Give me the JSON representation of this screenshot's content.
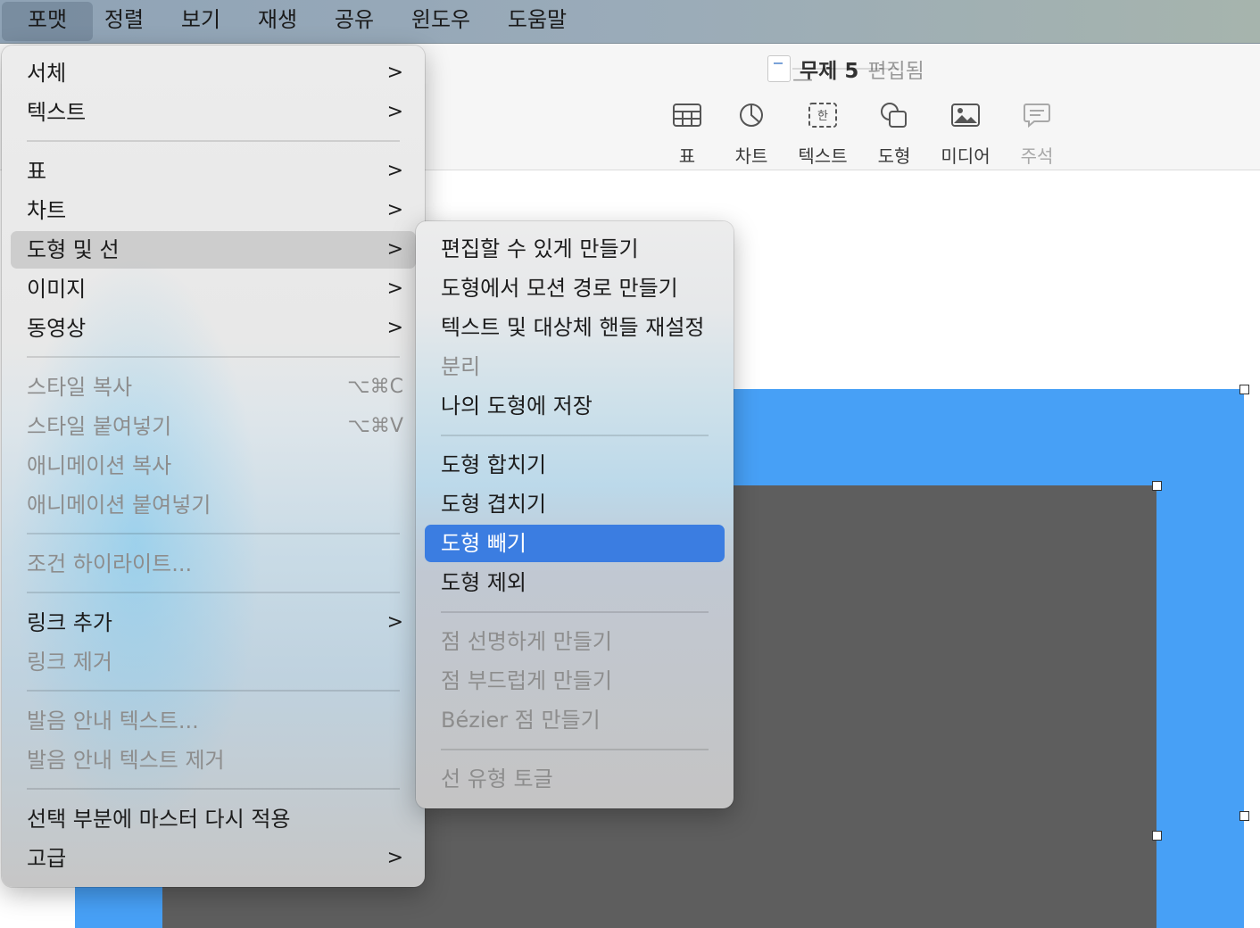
{
  "menubar": {
    "items": [
      "포맷",
      "정렬",
      "보기",
      "재생",
      "공유",
      "윈도우",
      "도움말"
    ]
  },
  "document": {
    "title": "무제 5",
    "separator": "—",
    "status": "편집됨"
  },
  "toolbar": {
    "table": "표",
    "chart": "차트",
    "text": "텍스트",
    "shape": "도형",
    "media": "미디어",
    "comment": "주석"
  },
  "format_menu": {
    "font": "서체",
    "text": "텍스트",
    "table": "표",
    "chart": "차트",
    "shape_line": "도형 및 선",
    "image": "이미지",
    "movie": "동영상",
    "copy_style": "스타일 복사",
    "copy_style_shortcut": "⌥⌘C",
    "paste_style": "스타일 붙여넣기",
    "paste_style_shortcut": "⌥⌘V",
    "copy_animation": "애니메이션 복사",
    "paste_animation": "애니메이션 붙여넣기",
    "conditional_highlight": "조건 하이라이트...",
    "add_link": "링크 추가",
    "remove_link": "링크 제거",
    "ruby_text": "발음 안내 텍스트...",
    "remove_ruby": "발음 안내 텍스트 제거",
    "reapply_master": "선택 부분에 마스터 다시 적용",
    "advanced": "고급",
    "arrow": ">"
  },
  "shapes_submenu": {
    "make_editable": "편집할 수 있게 만들기",
    "motion_path": "도형에서 모션 경로 만들기",
    "reset_handles": "텍스트 및 대상체 핸들 재설정",
    "break_apart": "분리",
    "save_to_my_shapes": "나의 도형에 저장",
    "unite": "도형 합치기",
    "intersect": "도형 겹치기",
    "subtract": "도형 빼기",
    "exclude": "도형 제외",
    "make_sharp": "점 선명하게 만들기",
    "make_smooth": "점 부드럽게 만들기",
    "make_bezier": "Bézier 점 만들기",
    "toggle_line_type": "선 유형 토글"
  },
  "colors": {
    "accent": "#3b7de1",
    "blue_shape": "#47a0f6",
    "gray_shape": "#5e5e5e"
  }
}
